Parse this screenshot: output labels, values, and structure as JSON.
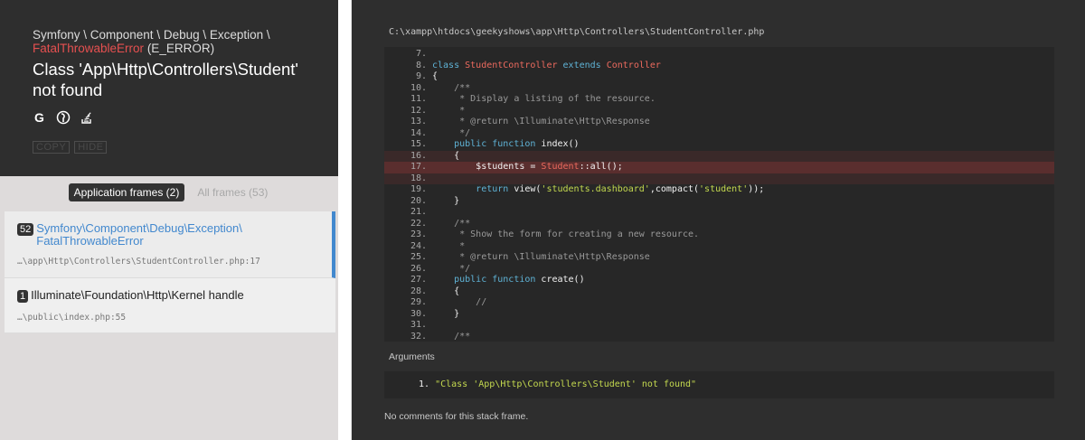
{
  "header": {
    "namespace": "Symfony \\ Component \\ Debug \\ Exception \\",
    "exception_name": "FatalThrowableError",
    "exception_code": "(E_ERROR)",
    "message": "Class 'App\\Http\\Controllers\\Student' not found",
    "search_icons": [
      "google-search-icon",
      "duckduckgo-search-icon",
      "stackoverflow-search-icon"
    ],
    "copy_label": "COPY",
    "hide_label": "HIDE"
  },
  "tabs": {
    "application": "Application frames (2)",
    "all": "All frames (53)"
  },
  "frames": [
    {
      "index": "52",
      "class": "Symfony\\Component\\Debug\\Exception\\ FatalThrowableError",
      "file": "…\\app\\Http\\Controllers\\StudentController.php:17"
    },
    {
      "index": "1",
      "class": "Illuminate\\Foundation\\Http\\Kernel handle",
      "file": "…\\public\\index.php:55"
    }
  ],
  "code": {
    "file_path": "C:\\xampp\\htdocs\\geekyshows\\app\\Http\\Controllers\\StudentController.php",
    "lines": [
      {
        "n": "7."
      },
      {
        "n": "8."
      },
      {
        "n": "9."
      },
      {
        "n": "10."
      },
      {
        "n": "11."
      },
      {
        "n": "12."
      },
      {
        "n": "13."
      },
      {
        "n": "14."
      },
      {
        "n": "15."
      },
      {
        "n": "16."
      },
      {
        "n": "17."
      },
      {
        "n": "18."
      },
      {
        "n": "19."
      },
      {
        "n": "20."
      },
      {
        "n": "21."
      },
      {
        "n": "22."
      },
      {
        "n": "23."
      },
      {
        "n": "24."
      },
      {
        "n": "25."
      },
      {
        "n": "26."
      },
      {
        "n": "27."
      },
      {
        "n": "28."
      },
      {
        "n": "29."
      },
      {
        "n": "30."
      },
      {
        "n": "31."
      },
      {
        "n": "32."
      }
    ],
    "tokens": {
      "l8_kw1": "class",
      "l8_cls1": "StudentController",
      "l8_kw2": "extends",
      "l8_cls2": "Controller",
      "l9": "{",
      "l10": "/**",
      "l11": " * Display a listing of the resource.",
      "l12": " *",
      "l13": " * @return \\Illuminate\\Http\\Response",
      "l14": " */",
      "l15_kw": "public function",
      "l15_rest": " index()",
      "l16": "{",
      "l17_var": "$students = ",
      "l17_cls": "Student",
      "l17_rest": "::all();",
      "l19_kw": "return",
      "l19_a": " view(",
      "l19_s1": "'students.dashboard'",
      "l19_b": ",compact(",
      "l19_s2": "'student'",
      "l19_c": "));",
      "l20": "}",
      "l22": "/**",
      "l23": " * Show the form for creating a new resource.",
      "l24": " *",
      "l25": " * @return \\Illuminate\\Http\\Response",
      "l26": " */",
      "l27_kw": "public function",
      "l27_rest": " create()",
      "l28": "{",
      "l29": "//",
      "l30": "}",
      "l32": "/**"
    }
  },
  "arguments": {
    "title": "Arguments",
    "items": [
      {
        "index": "1.",
        "value": "\"Class 'App\\Http\\Controllers\\Student' not found\""
      }
    ]
  },
  "comments": "No comments for this stack frame.",
  "colors": {
    "accent_blue": "#4288ce",
    "error_red": "#e65050",
    "panel_dark": "#2e2e2e",
    "code_bg": "#272727"
  }
}
